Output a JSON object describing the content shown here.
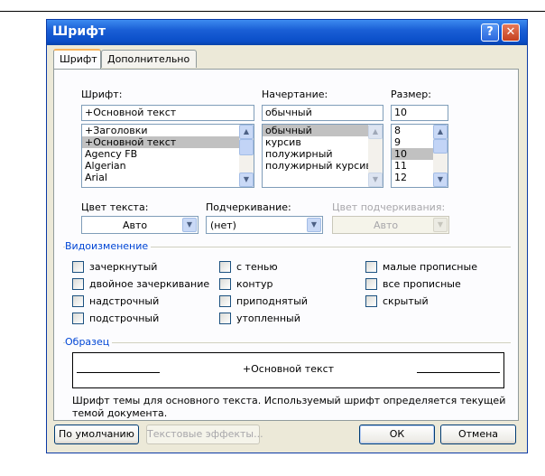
{
  "dialog": {
    "title": "Шрифт",
    "help_label": "?",
    "close_label": "✕"
  },
  "tabs": [
    {
      "label": "Шрифт",
      "active": true
    },
    {
      "label": "Дополнительно",
      "active": false
    }
  ],
  "font": {
    "label": "Шрифт:",
    "value": "+Основной текст",
    "items": [
      "+Заголовки",
      "+Основной текст",
      "Agency FB",
      "Algerian",
      "Arial"
    ],
    "selected_index": 1
  },
  "style": {
    "label": "Начертание:",
    "value": "обычный",
    "items": [
      "обычный",
      "курсив",
      "полужирный",
      "полужирный курсив"
    ],
    "selected_index": 0
  },
  "size": {
    "label": "Размер:",
    "value": "10",
    "items": [
      "8",
      "9",
      "10",
      "11",
      "12"
    ],
    "selected_index": 2
  },
  "text_color": {
    "label": "Цвет текста:",
    "value": "Авто"
  },
  "underline": {
    "label": "Подчеркивание:",
    "value": "(нет)"
  },
  "underline_color": {
    "label": "Цвет подчеркивания:",
    "value": "Авто",
    "disabled": true
  },
  "effects": {
    "title": "Видоизменение",
    "items": [
      {
        "label": "зачеркнутый",
        "checked": false
      },
      {
        "label": "с тенью",
        "checked": false
      },
      {
        "label": "малые прописные",
        "checked": false
      },
      {
        "label": "двойное зачеркивание",
        "checked": false
      },
      {
        "label": "контур",
        "checked": false
      },
      {
        "label": "все прописные",
        "checked": false
      },
      {
        "label": "надстрочный",
        "checked": false
      },
      {
        "label": "приподнятый",
        "checked": false
      },
      {
        "label": "скрытый",
        "checked": false
      },
      {
        "label": "подстрочный",
        "checked": false
      },
      {
        "label": "утопленный",
        "checked": false
      }
    ]
  },
  "preview": {
    "title": "Образец",
    "sample_text": "+Основной текст",
    "description": "Шрифт темы для основного текста. Используемый шрифт определяется текущей темой документа."
  },
  "buttons": {
    "default_label": "По умолчанию",
    "text_effects_label": "Текстовые эффекты...",
    "ok_label": "ОК",
    "cancel_label": "Отмена"
  }
}
